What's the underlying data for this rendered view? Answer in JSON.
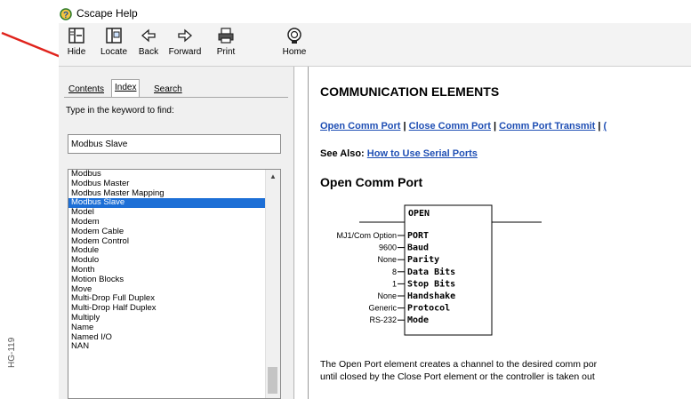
{
  "window": {
    "title": "Cscape Help"
  },
  "toolbar": {
    "buttons": [
      {
        "label": "Hide",
        "icon": "hide-icon"
      },
      {
        "label": "Locate",
        "icon": "locate-icon"
      },
      {
        "label": "Back",
        "icon": "back-arrow-icon"
      },
      {
        "label": "Forward",
        "icon": "forward-arrow-icon"
      },
      {
        "label": "Print",
        "icon": "print-icon"
      },
      {
        "label": "Home",
        "icon": "home-icon"
      }
    ]
  },
  "left_pane": {
    "tabs": [
      {
        "label": "Contents",
        "active": false
      },
      {
        "label": "Index",
        "active": true
      },
      {
        "label": "Search",
        "active": false
      }
    ],
    "keyword_label": "Type in the keyword to find:",
    "keyword_value": "Modbus Slave",
    "index_items": [
      "Modbus",
      "Modbus Master",
      "Modbus Master Mapping",
      "Modbus Slave",
      "Model",
      "Modem",
      "Modem Cable",
      "Modem Control",
      "Module",
      "Modulo",
      "Month",
      "Motion Blocks",
      "Move",
      "Multi-Drop Full Duplex",
      "Multi-Drop Half Duplex",
      "Multiply",
      "Name",
      "Named I/O",
      "NAN"
    ],
    "selected_index": 3
  },
  "content": {
    "title": "COMMUNICATION ELEMENTS",
    "links": [
      "Open Comm Port",
      "Close Comm Port",
      "Comm  Port Transmit",
      "("
    ],
    "see_also_label": "See Also:",
    "see_also_link": "How to Use Serial Ports",
    "section_title": "Open Comm Port",
    "block": {
      "name": "OPEN",
      "pins": [
        {
          "input": "MJ1/Com Option",
          "label": "PORT"
        },
        {
          "input": "9600",
          "label": "Baud"
        },
        {
          "input": "None",
          "label": "Parity"
        },
        {
          "input": "8",
          "label": "Data Bits"
        },
        {
          "input": "1",
          "label": "Stop Bits"
        },
        {
          "input": "None",
          "label": "Handshake"
        },
        {
          "input": "Generic",
          "label": "Protocol"
        },
        {
          "input": "RS-232",
          "label": "Mode"
        }
      ]
    },
    "description": [
      "The Open Port element creates a channel to the desired comm por",
      "until closed by the Close Port element or the controller is taken out"
    ]
  },
  "margin_code": "HG-119",
  "colors": {
    "selection": "#1d6fd6",
    "link": "#1f4fb4",
    "annotation_arrow": "#e0231c"
  }
}
